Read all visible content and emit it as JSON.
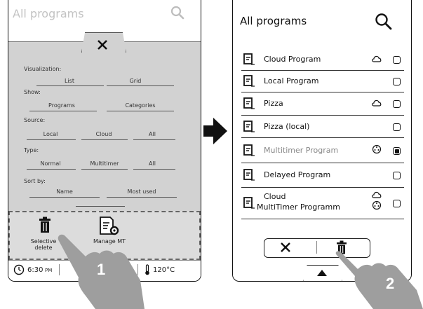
{
  "left": {
    "title": "All programs",
    "sections": {
      "visualization": {
        "label": "Visualization:",
        "options": [
          "List",
          "Grid"
        ]
      },
      "show": {
        "label": "Show:",
        "options": [
          "Programs",
          "Categories"
        ]
      },
      "source": {
        "label": "Source:",
        "options": [
          "Local",
          "Cloud",
          "All"
        ]
      },
      "type": {
        "label": "Type:",
        "options": [
          "Normal",
          "Multitimer",
          "All"
        ]
      },
      "sortby": {
        "label": "Sort by:",
        "options": [
          "Name",
          "Most used"
        ]
      }
    },
    "tools": {
      "selective_delete": "Selective delete",
      "manage_mt": "Manage MT"
    },
    "status": {
      "time": "6:30",
      "ampm": "PM",
      "temp": "120°C"
    },
    "step": "1"
  },
  "right": {
    "title": "All programs",
    "programs": [
      {
        "name": "Cloud Program",
        "cloud": true,
        "multitimer": false,
        "checked": false,
        "dim": false
      },
      {
        "name": "Local Program",
        "cloud": false,
        "multitimer": false,
        "checked": false,
        "dim": false
      },
      {
        "name": "Pizza",
        "cloud": true,
        "multitimer": false,
        "checked": false,
        "dim": false
      },
      {
        "name": "Pizza (local)",
        "cloud": false,
        "multitimer": false,
        "checked": false,
        "dim": false
      },
      {
        "name": "Multitimer Program",
        "cloud": false,
        "multitimer": true,
        "checked": true,
        "dim": true
      },
      {
        "name": "Delayed Program",
        "cloud": false,
        "multitimer": false,
        "checked": false,
        "dim": false
      },
      {
        "name": "Cloud",
        "name2": "MultiTimer Programm",
        "cloud": true,
        "multitimer": true,
        "checked": false,
        "dim": false
      }
    ],
    "step": "2"
  },
  "colors": {
    "panel": "#d2d2d2",
    "hand": "#9e9e9e",
    "line": "#111111"
  },
  "icons": [
    "search-icon",
    "close-icon",
    "trash-icon",
    "gear-document-icon",
    "clock-icon",
    "thermometer-icon",
    "arrow-right-icon",
    "cloud-icon",
    "document-icon",
    "caret-up-icon"
  ]
}
